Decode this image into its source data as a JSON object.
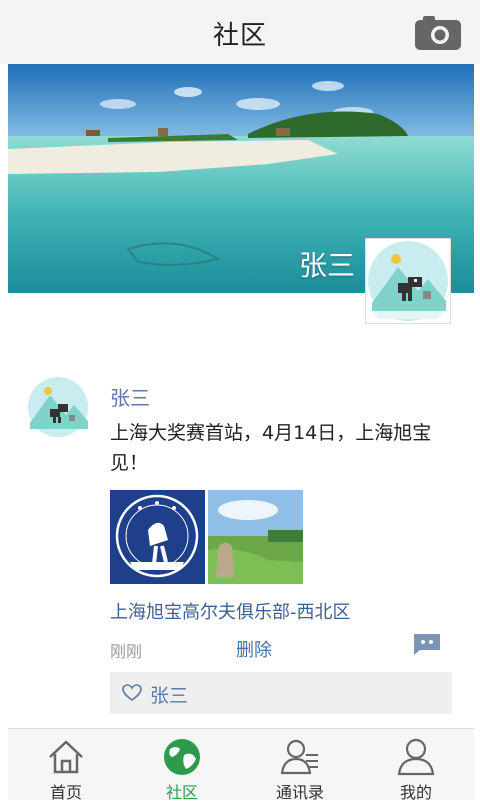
{
  "header": {
    "title": "社区",
    "camera_icon": "camera-icon"
  },
  "cover": {
    "user_name": "张三",
    "avatar_icon": "dinosaur-avatar"
  },
  "post": {
    "author": "张三",
    "content": "上海大奖赛首站，4月14日，上海旭宝见！",
    "images": [
      "golf-competition-logo",
      "golf-course-photo"
    ],
    "location": "上海旭宝高尔夫俱乐部-西北区",
    "time": "刚刚",
    "delete_label": "删除",
    "likes": [
      "张三"
    ]
  },
  "tabs": [
    {
      "label": "首页",
      "icon": "home-icon",
      "active": false
    },
    {
      "label": "社区",
      "icon": "globe-icon",
      "active": true
    },
    {
      "label": "通讯录",
      "icon": "contacts-icon",
      "active": false
    },
    {
      "label": "我的",
      "icon": "user-icon",
      "active": false
    }
  ],
  "colors": {
    "accent": "#2f9a4e",
    "link": "#5b79a8",
    "header_bg": "#f4f4f4"
  }
}
